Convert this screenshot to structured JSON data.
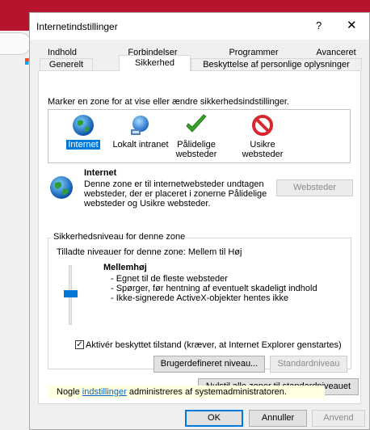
{
  "window": {
    "title": "Internetindstillinger",
    "help_glyph": "?",
    "close_glyph": "✕"
  },
  "tabs": {
    "row1": [
      "Indhold",
      "Forbindelser",
      "Programmer",
      "Avanceret"
    ],
    "row2": [
      "Generelt",
      "Sikkerhed",
      "Beskyttelse af personlige oplysninger"
    ],
    "active": "Sikkerhed"
  },
  "security": {
    "instruction": "Marker en zone for at vise eller ændre sikkerhedsindstillinger.",
    "zones": [
      {
        "label": "Internet",
        "icon": "globe-icon",
        "selected": true
      },
      {
        "label": "Lokalt intranet",
        "icon": "network-globe-icon",
        "selected": false
      },
      {
        "label": "Pålidelige websteder",
        "icon": "green-check-icon",
        "selected": false
      },
      {
        "label": "Usikre websteder",
        "icon": "no-entry-icon",
        "selected": false
      }
    ],
    "zone_info": {
      "name": "Internet",
      "description": "Denne zone er til internetwebsteder undtagen websteder, der er placeret i zonerne Pålidelige websteder og Usikre websteder."
    },
    "websites_button": "Websteder",
    "level_group_title": "Sikkerhedsniveau for denne zone",
    "allowed_levels": "Tilladte niveauer for denne zone: Mellem til Høj",
    "level": {
      "name": "Mellemhøj",
      "slider_position": "middle",
      "bullets": [
        "- Egnet til de fleste websteder",
        "- Spørger, før hentning af eventuelt skadeligt indhold",
        "- Ikke-signerede ActiveX-objekter hentes ikke"
      ]
    },
    "protected_mode": {
      "label": "Aktivér beskyttet tilstand (kræver, at Internet Explorer genstartes)",
      "checked": true
    },
    "custom_level_button": "Brugerdefineret niveau...",
    "default_level_button": "Standardniveau",
    "reset_all_button": "Nulstil alle zoner til standardniveauet",
    "admin_notice": {
      "before": "Nogle ",
      "link": "indstillinger",
      "after": " administreres af systemadministratoren."
    }
  },
  "footer": {
    "ok": "OK",
    "cancel": "Annuller",
    "apply": "Anvend"
  },
  "colors": {
    "background": "#b5142c",
    "dialog": "#f0f0f0",
    "accent": "#0078d7",
    "infobar": "#ffffe1"
  }
}
